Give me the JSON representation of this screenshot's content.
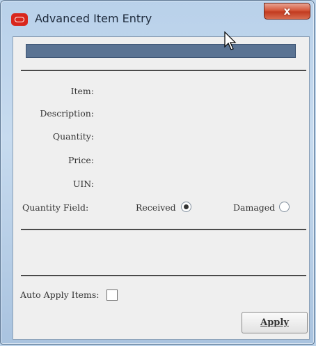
{
  "window": {
    "title": "Advanced Item Entry",
    "close_label": "x"
  },
  "form": {
    "item_label": "Item:",
    "description_label": "Description:",
    "quantity_label": "Quantity:",
    "price_label": "Price:",
    "uin_label": "UIN:",
    "quantity_field_label": "Quantity Field:",
    "received_label": "Received",
    "damaged_label": "Damaged",
    "selected_option": "Received"
  },
  "footer": {
    "auto_apply_label": "Auto Apply Items:",
    "auto_apply_checked": false,
    "apply_label": "Apply"
  },
  "colors": {
    "progress_bar": "#5a7393",
    "close_button": "#c23b20",
    "app_logo": "#d9261c"
  },
  "icons": {
    "app_logo": "oracle-logo-icon",
    "cursor": "mouse-cursor-icon"
  }
}
